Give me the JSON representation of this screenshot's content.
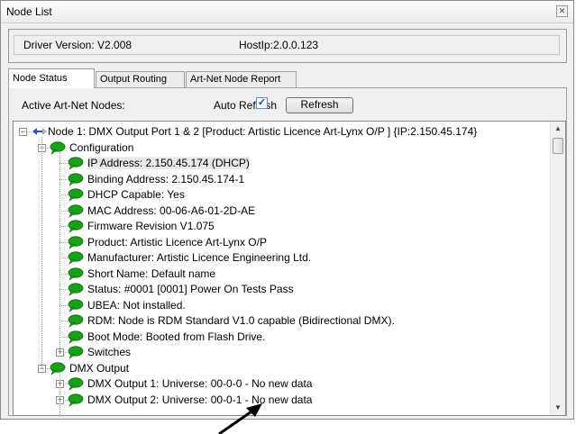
{
  "window": {
    "title": "Node List",
    "close_glyph": "✕"
  },
  "info": {
    "driver_version": "Driver Version: V2.008",
    "host_ip": "HostIp:2.0.0.123"
  },
  "tabs": [
    {
      "label": "Node Status",
      "active": true
    },
    {
      "label": "Output Routing",
      "active": false
    },
    {
      "label": "Art-Net Node Report",
      "active": false
    }
  ],
  "controls": {
    "active_nodes_label": "Active Art-Net Nodes:",
    "auto_refresh_label": "Auto Refresh",
    "auto_refresh_checked": true,
    "refresh_label": "Refresh"
  },
  "tree": {
    "bubble_color": "#18a018",
    "nodes": [
      {
        "level": 0,
        "text": "Node 1: DMX Output Port 1 & 2 [Product: Artistic Licence  Art-Lynx O/P    ] {IP:2.150.45.174}",
        "expander": "minus",
        "icon": "network-node-icon"
      },
      {
        "level": 1,
        "text": "Configuration",
        "expander": "minus",
        "icon": "speech-bubble-icon"
      },
      {
        "level": 2,
        "text": "IP Address: 2.150.45.174 (DHCP)",
        "icon": "speech-bubble-icon",
        "selected": true
      },
      {
        "level": 2,
        "text": "Binding Address: 2.150.45.174-1",
        "icon": "speech-bubble-icon"
      },
      {
        "level": 2,
        "text": "DHCP Capable: Yes",
        "icon": "speech-bubble-icon"
      },
      {
        "level": 2,
        "text": "MAC Address: 00-06-A6-01-2D-AE",
        "icon": "speech-bubble-icon"
      },
      {
        "level": 2,
        "text": "Firmware Revision V1.075",
        "icon": "speech-bubble-icon"
      },
      {
        "level": 2,
        "text": "Product: Artistic Licence  Art-Lynx O/P",
        "icon": "speech-bubble-icon"
      },
      {
        "level": 2,
        "text": "Manufacturer: Artistic Licence Engineering Ltd.",
        "icon": "speech-bubble-icon"
      },
      {
        "level": 2,
        "text": "Short Name: Default name",
        "icon": "speech-bubble-icon"
      },
      {
        "level": 2,
        "text": "Status: #0001 [0001] Power On Tests Pass",
        "icon": "speech-bubble-icon"
      },
      {
        "level": 2,
        "text": "UBEA: Not installed.",
        "icon": "speech-bubble-icon"
      },
      {
        "level": 2,
        "text": "RDM: Node is RDM Standard V1.0 capable (Bidirectional DMX).",
        "icon": "speech-bubble-icon"
      },
      {
        "level": 2,
        "text": "Boot Mode: Booted from Flash Drive.",
        "icon": "speech-bubble-icon"
      },
      {
        "level": 2,
        "text": "Switches",
        "expander": "plus",
        "icon": "speech-bubble-icon"
      },
      {
        "level": 1,
        "text": "DMX Output",
        "expander": "minus",
        "icon": "speech-bubble-icon"
      },
      {
        "level": 2,
        "text": "DMX Output 1: Universe: 00-0-0  - No new data",
        "expander": "plus",
        "icon": "speech-bubble-icon"
      },
      {
        "level": 2,
        "text": "DMX Output 2: Universe: 00-0-1  - No new data",
        "expander": "plus",
        "icon": "speech-bubble-icon"
      }
    ]
  }
}
